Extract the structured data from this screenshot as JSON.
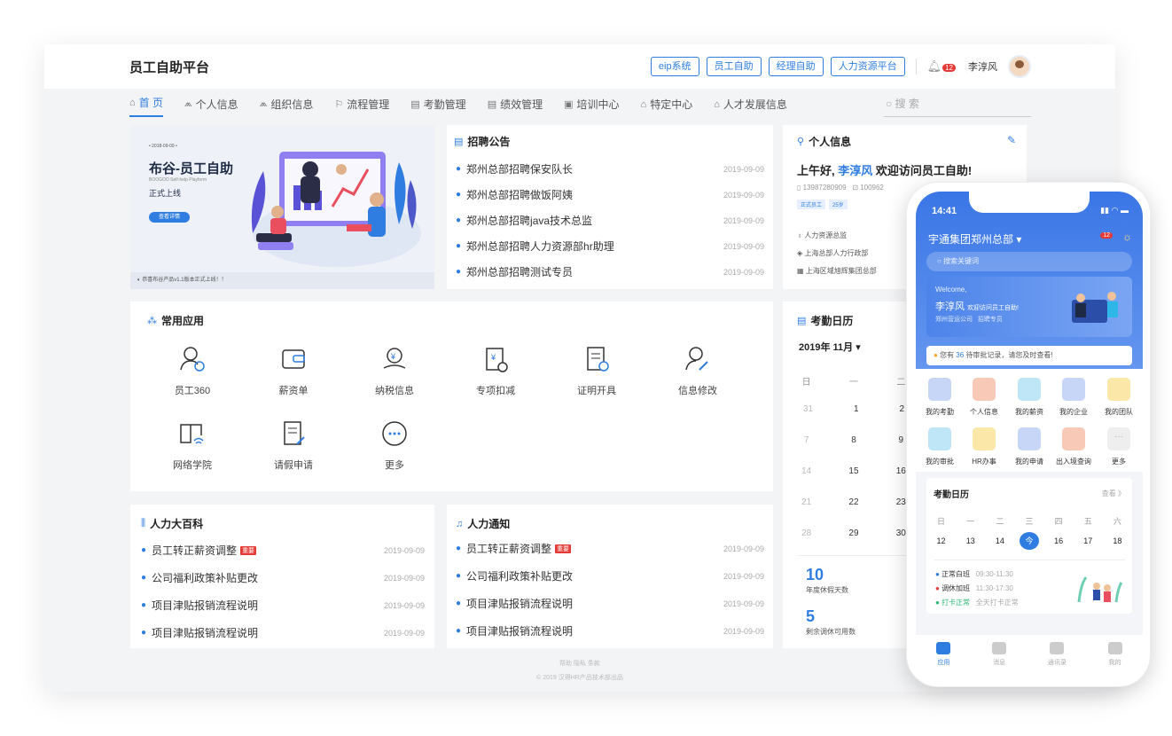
{
  "header": {
    "title": "员工自助平台",
    "buttons": [
      "eip系统",
      "员工自助",
      "经理自助",
      "人力资源平台"
    ],
    "notification_count": "12",
    "username": "李淳风"
  },
  "nav": {
    "items": [
      {
        "label": "首 页",
        "icon": "⌂"
      },
      {
        "label": "个人信息",
        "icon": "⩕"
      },
      {
        "label": "组织信息",
        "icon": "⩕"
      },
      {
        "label": "流程管理",
        "icon": "⚐"
      },
      {
        "label": "考勤管理",
        "icon": "▤"
      },
      {
        "label": "绩效管理",
        "icon": "▤"
      },
      {
        "label": "培训中心",
        "icon": "▣"
      },
      {
        "label": "特定中心",
        "icon": "⌂"
      },
      {
        "label": "人才发展信息",
        "icon": "⌂"
      }
    ],
    "search_placeholder": "搜 索"
  },
  "banner": {
    "date": "• 2018-09-09 •",
    "title": "布谷-员工自助",
    "subtitle": "BOOGOO Self-help Playform",
    "tagline": "正式上线",
    "button": "查看详情",
    "notice": "恭喜布谷产品v1.1版本正式上线！！"
  },
  "recruit": {
    "title": "招聘公告",
    "items": [
      {
        "text": "郑州总部招聘保安队长",
        "date": "2019-09-09"
      },
      {
        "text": "郑州总部招聘做饭阿姨",
        "date": "2019-09-09"
      },
      {
        "text": "郑州总部招聘java技术总监",
        "date": "2019-09-09"
      },
      {
        "text": "郑州总部招聘人力资源部hr助理",
        "date": "2019-09-09"
      },
      {
        "text": "郑州总部招聘测试专员",
        "date": "2019-09-09"
      }
    ]
  },
  "profile": {
    "title": "个人信息",
    "greeting": "上午好,",
    "name": "李淳风",
    "welcome": "欢迎访问员工自助!",
    "phone": "13987280909",
    "id": "100962",
    "tags": [
      "正式员工",
      "25岁"
    ],
    "dept": "人力资源总监",
    "org": "上海总部人力行政部",
    "group": "上海区域旭辉集团总部"
  },
  "apps": {
    "title": "常用应用",
    "items": [
      "员工360",
      "薪资单",
      "纳税信息",
      "专项扣减",
      "证明开具",
      "信息修改",
      "网络学院",
      "请假申请",
      "更多"
    ]
  },
  "attendance": {
    "title": "考勤日历",
    "month": "2019年 11月 ▾",
    "weekdays": [
      "日",
      "一",
      "二"
    ],
    "rows": [
      [
        "31",
        "1",
        "2"
      ],
      [
        "7",
        "8",
        "9"
      ],
      [
        "14",
        "15",
        "16"
      ],
      [
        "21",
        "22",
        "23"
      ],
      [
        "28",
        "29",
        "30"
      ]
    ],
    "annual_days": "10",
    "annual_label": "年度休假天数",
    "adjust_days": "5",
    "adjust_label": "剩余调休可用数"
  },
  "wiki": {
    "title": "人力大百科",
    "items": [
      {
        "text": "员工转正薪资调整",
        "tag": "重要",
        "date": "2019-09-09"
      },
      {
        "text": "公司福利政策补贴更改",
        "date": "2019-09-09"
      },
      {
        "text": "项目津贴报销流程说明",
        "date": "2019-09-09"
      },
      {
        "text": "项目津贴报销流程说明",
        "date": "2019-09-09"
      }
    ]
  },
  "hrnotice": {
    "title": "人力通知",
    "items": [
      {
        "text": "员工转正薪资调整",
        "tag": "重要",
        "date": "2019-09-09"
      },
      {
        "text": "公司福利政策补贴更改",
        "date": "2019-09-09"
      },
      {
        "text": "项目津贴报销流程说明",
        "date": "2019-09-09"
      },
      {
        "text": "项目津贴报销流程说明",
        "date": "2019-09-09"
      }
    ]
  },
  "footer": {
    "links": "帮助    隐私    条款",
    "copyright": "© 2019 汉得HR产品技术部出品"
  },
  "phone": {
    "time": "14:41",
    "company": "宇通集团郑州总部 ▾",
    "badge": "12",
    "search": "搜索关键词",
    "banner_welcome": "Welcome,",
    "banner_name": "李淳风",
    "banner_greet": "欢迎访问员工自助!",
    "banner_org": "郑州营运公司",
    "banner_role": "招聘专员",
    "notice_pre": "您有",
    "notice_count": "36",
    "notice_post": "待审批记录，请您及时查看!",
    "icons": [
      {
        "label": "我的考勤",
        "color": "#c7d6f7"
      },
      {
        "label": "个人信息",
        "color": "#f9c9b8"
      },
      {
        "label": "我的薪资",
        "color": "#bfe6f6"
      },
      {
        "label": "我的企业",
        "color": "#c7d6f7"
      },
      {
        "label": "我的团队",
        "color": "#fbe7a8"
      },
      {
        "label": "我的审批",
        "color": "#bfe6f6"
      },
      {
        "label": "HR办事",
        "color": "#fbe7a8"
      },
      {
        "label": "我的申请",
        "color": "#c7d6f7"
      },
      {
        "label": "出入境查询",
        "color": "#f9c9b8"
      },
      {
        "label": "更多",
        "color": "#eeeeee"
      }
    ],
    "cal_title": "考勤日历",
    "cal_more": "查看 》",
    "cal_weekdays": [
      "日",
      "一",
      "二",
      "三",
      "四",
      "五",
      "六"
    ],
    "cal_days": [
      "12",
      "13",
      "14",
      "今",
      "16",
      "17",
      "18"
    ],
    "shifts": [
      {
        "name": "正常白班",
        "time": "09:30-11:30",
        "color": "#2f7de1"
      },
      {
        "name": "调休加班",
        "time": "11:30-17:30",
        "color": "#e53935"
      },
      {
        "name": "打卡正常",
        "time": "全天打卡正常",
        "color": "#2bb673"
      }
    ],
    "tabs": [
      "应用",
      "消息",
      "通讯录",
      "我的"
    ]
  }
}
